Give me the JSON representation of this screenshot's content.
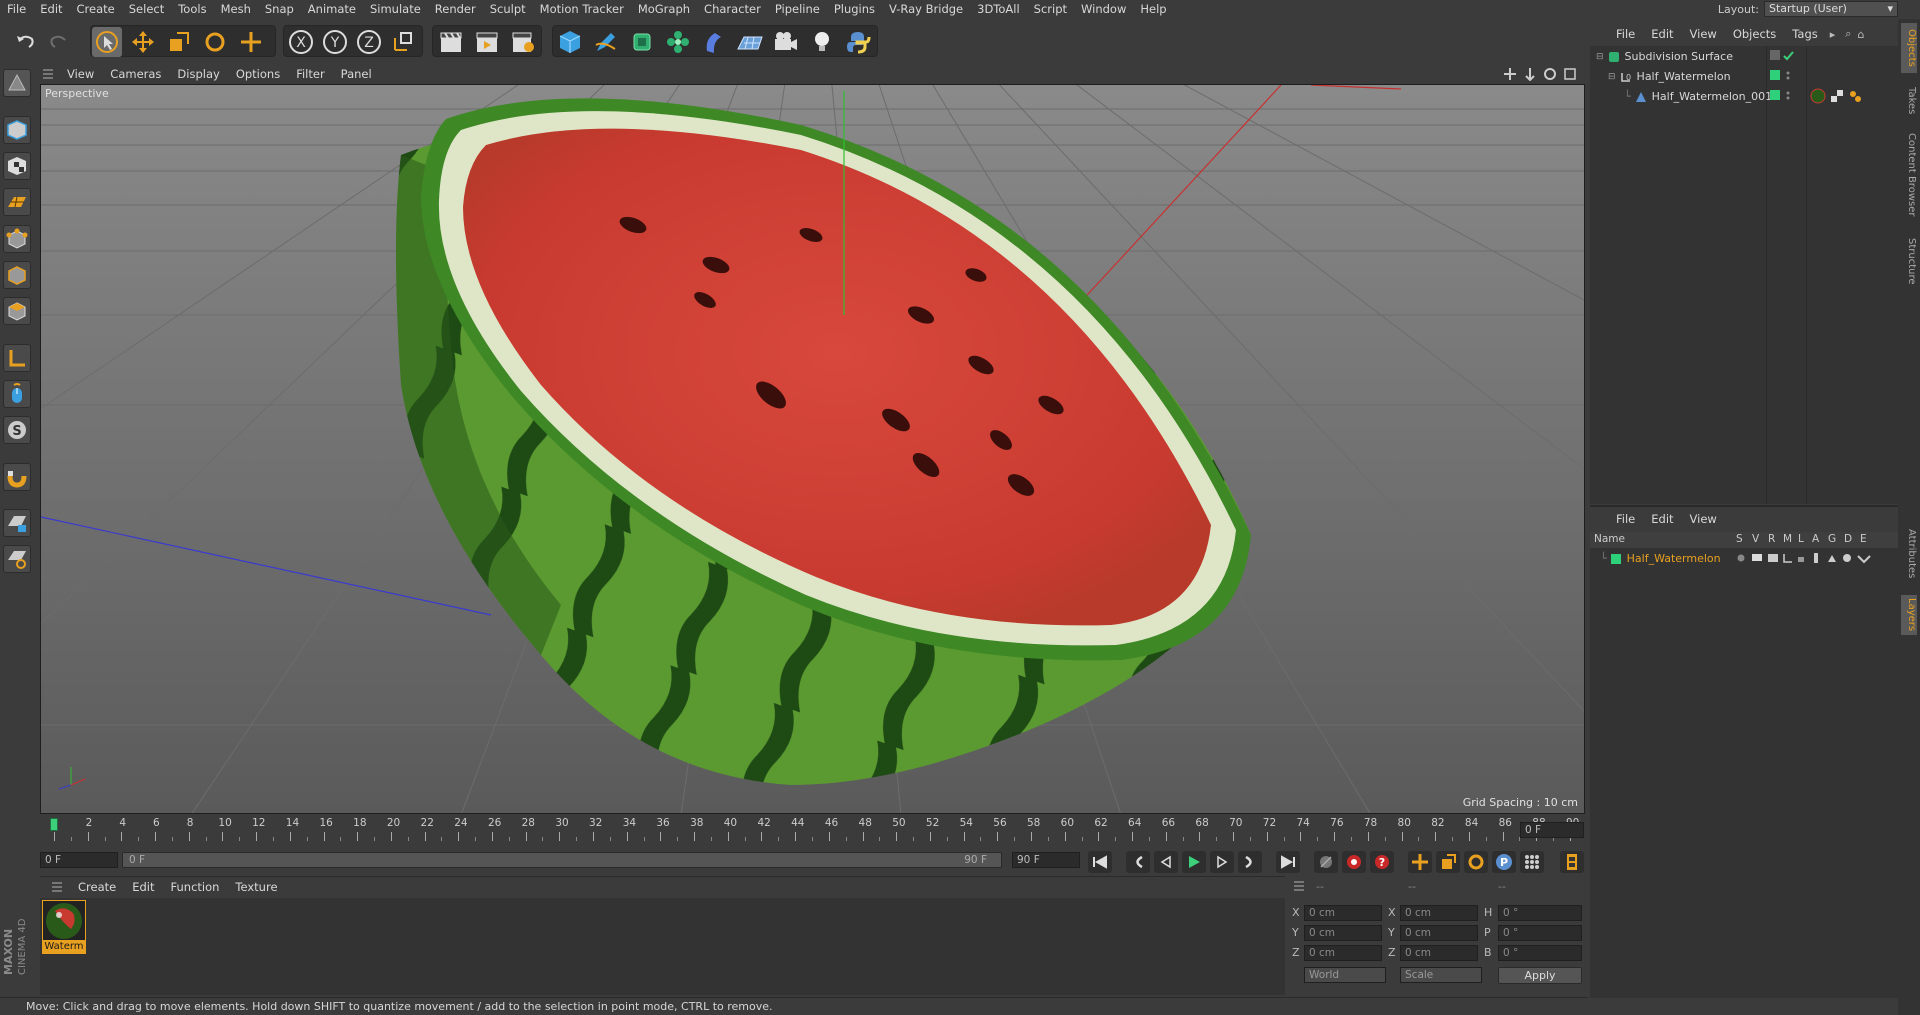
{
  "menubar": {
    "items": [
      "File",
      "Edit",
      "Create",
      "Select",
      "Tools",
      "Mesh",
      "Snap",
      "Animate",
      "Simulate",
      "Render",
      "Sculpt",
      "Motion Tracker",
      "MoGraph",
      "Character",
      "Pipeline",
      "Plugins",
      "V-Ray Bridge",
      "3DToAll",
      "Script",
      "Window",
      "Help"
    ],
    "layout_label": "Layout:",
    "layout_value": "Startup (User)"
  },
  "viewport": {
    "menu": [
      "View",
      "Cameras",
      "Display",
      "Options",
      "Filter",
      "Panel"
    ],
    "label": "Perspective",
    "grid_spacing": "Grid Spacing : 10 cm"
  },
  "timeline": {
    "ticks": [
      "0",
      "2",
      "4",
      "6",
      "8",
      "10",
      "12",
      "14",
      "16",
      "18",
      "20",
      "22",
      "24",
      "26",
      "28",
      "30",
      "32",
      "34",
      "36",
      "38",
      "40",
      "42",
      "44",
      "46",
      "48",
      "50",
      "52",
      "54",
      "56",
      "58",
      "60",
      "62",
      "64",
      "66",
      "68",
      "70",
      "72",
      "74",
      "76",
      "78",
      "80",
      "82",
      "84",
      "86",
      "88",
      "90"
    ],
    "current_frame": "0 F",
    "start_field": "0 F",
    "range_start": "0 F",
    "range_end": "90 F",
    "end_field": "90 F"
  },
  "materials": {
    "menu": [
      "Create",
      "Edit",
      "Function",
      "Texture"
    ],
    "items": [
      {
        "name": "Waterm"
      }
    ]
  },
  "coordinates": {
    "header": [
      "--",
      "--",
      "--"
    ],
    "rows": [
      {
        "a_label": "X",
        "a_val": "0 cm",
        "b_label": "X",
        "b_val": "0 cm",
        "c_label": "H",
        "c_val": "0 °"
      },
      {
        "a_label": "Y",
        "a_val": "0 cm",
        "b_label": "Y",
        "b_val": "0 cm",
        "c_label": "P",
        "c_val": "0 °"
      },
      {
        "a_label": "Z",
        "a_val": "0 cm",
        "b_label": "Z",
        "b_val": "0 cm",
        "c_label": "B",
        "c_val": "0 °"
      }
    ],
    "mode1": "World",
    "mode2": "Scale",
    "apply": "Apply"
  },
  "status": "Move: Click and drag to move elements. Hold down SHIFT to quantize movement / add to the selection in point mode, CTRL to remove.",
  "objects": {
    "menu": [
      "File",
      "Edit",
      "View",
      "Objects",
      "Tags"
    ],
    "rows": [
      {
        "name": "Subdivision Surface"
      },
      {
        "name": "Half_Watermelon"
      },
      {
        "name": "Half_Watermelon_001"
      }
    ]
  },
  "layers": {
    "menu": [
      "File",
      "Edit",
      "View"
    ],
    "columns": [
      "Name",
      "S",
      "V",
      "R",
      "M",
      "L",
      "A",
      "G",
      "D",
      "E"
    ],
    "rows": [
      {
        "name": "Half_Watermelon"
      }
    ]
  },
  "right_tabs": [
    "Objects",
    "Takes",
    "Content Browser",
    "Structure",
    "Attributes",
    "Layers"
  ],
  "colors": {
    "accent": "#e8a020",
    "green_tag": "#2fd07a"
  }
}
